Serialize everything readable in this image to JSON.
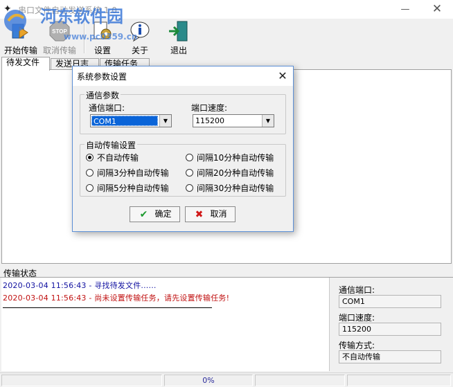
{
  "window": {
    "title": "串口文件自动发送系统 1.0",
    "watermark_name": "河东软件园",
    "watermark_url": "www.pc0359.cn",
    "minimize_glyph": "—",
    "close_glyph": "✕"
  },
  "toolbar": {
    "buttons": [
      {
        "label": "开始传输",
        "icon": "start-transfer-icon",
        "enabled": true
      },
      {
        "label": "取消传输",
        "icon": "stop-icon",
        "enabled": false
      },
      {
        "label": "设置",
        "icon": "settings-icon",
        "enabled": true
      },
      {
        "label": "关于",
        "icon": "info-icon",
        "enabled": true
      },
      {
        "label": "退出",
        "icon": "exit-door-icon",
        "enabled": true
      }
    ]
  },
  "tabs": [
    {
      "label": "待发文件",
      "active": true
    },
    {
      "label": "发送日志",
      "active": false
    },
    {
      "label": "传输任务",
      "active": false
    }
  ],
  "status": {
    "title": "传输状态",
    "log": [
      {
        "time": "2020-03-04 11:56:43",
        "message": "寻找待发文件......",
        "color": "#1010a0"
      },
      {
        "time": "2020-03-04 11:56:43",
        "message": "尚未设置传输任务，请先设置传输任务!",
        "color": "#c01010"
      }
    ],
    "port_label": "通信端口:",
    "port_value": "COM1",
    "speed_label": "端口速度:",
    "speed_value": "115200",
    "mode_label": "传输方式:",
    "mode_value": "不自动传输"
  },
  "statusbar": {
    "progress": "0%"
  },
  "dialog": {
    "title": "系统参数设置",
    "close_glyph": "✕",
    "comm_group": "通信参数",
    "port_label": "通信端口:",
    "port_value": "COM1",
    "speed_label": "端口速度:",
    "speed_value": "115200",
    "auto_group": "自动传输设置",
    "options": [
      {
        "label": "不自动传输",
        "checked": true
      },
      {
        "label": "间隔10分种自动传输",
        "checked": false
      },
      {
        "label": "间隔3分种自动传输",
        "checked": false
      },
      {
        "label": "间隔20分种自动传输",
        "checked": false
      },
      {
        "label": "间隔5分种自动传输",
        "checked": false
      },
      {
        "label": "间隔30分种自动传输",
        "checked": false
      }
    ],
    "ok_label": "确定",
    "cancel_label": "取消"
  },
  "colors": {
    "accent": "#0a64d8",
    "log_blue": "#1010a0",
    "log_red": "#c01010",
    "dialog_border": "#5b8fd6"
  }
}
